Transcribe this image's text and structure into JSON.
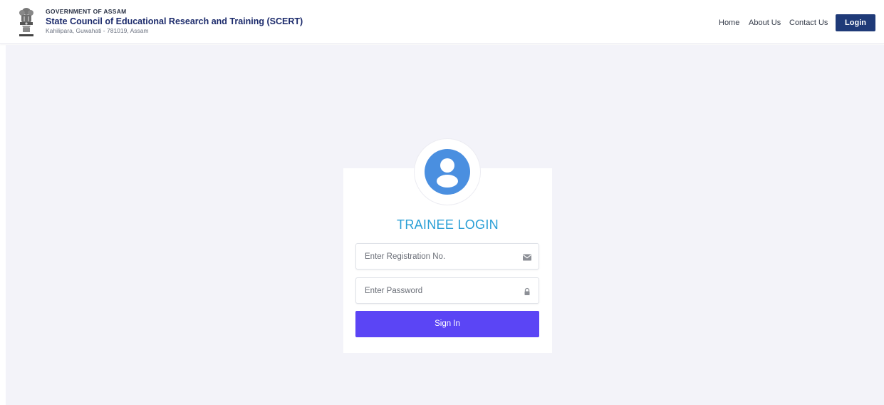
{
  "header": {
    "gov_name": "GOVERNMENT OF ASSAM",
    "org_name": "State Council of Educational Research and Training (SCERT)",
    "address": "Kahilipara, Guwahati - 781019, Assam",
    "emblem_icon": "state-emblem-icon"
  },
  "nav": {
    "items": [
      {
        "label": "Home"
      },
      {
        "label": "About Us"
      },
      {
        "label": "Contact Us"
      }
    ],
    "login_label": "Login"
  },
  "login_card": {
    "avatar_icon": "user-avatar-icon",
    "title": "TRAINEE LOGIN",
    "registration": {
      "placeholder": "Enter Registration No.",
      "value": "",
      "icon": "envelope-icon"
    },
    "password": {
      "placeholder": "Enter Password",
      "value": "",
      "icon": "lock-icon"
    },
    "signin_label": "Sign In"
  },
  "colors": {
    "brand_navy": "#1f3a78",
    "title_blue": "#2a9fd6",
    "avatar_blue": "#4a8fe0",
    "signin_purple": "#5b45f5",
    "page_bg": "#f3f3f9"
  }
}
